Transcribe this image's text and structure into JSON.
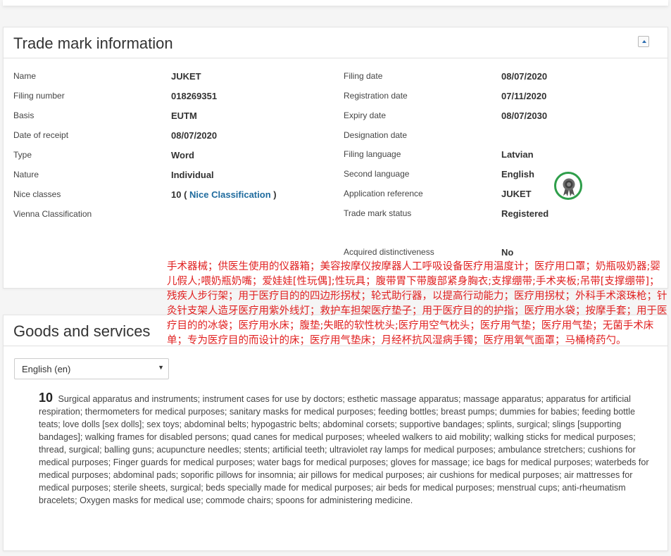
{
  "trade_mark": {
    "title": "Trade mark information",
    "left": [
      {
        "label": "Name",
        "value": "JUKET"
      },
      {
        "label": "Filing number",
        "value": "018269351"
      },
      {
        "label": "Basis",
        "value": "EUTM"
      },
      {
        "label": "Date of receipt",
        "value": "08/07/2020"
      },
      {
        "label": "Type",
        "value": "Word"
      },
      {
        "label": "Nature",
        "value": "Individual"
      },
      {
        "label": "Nice classes",
        "value_prefix": "10 (",
        "link": "Nice Classification",
        "value_suffix": ")"
      },
      {
        "label": "Vienna Classification",
        "value": ""
      }
    ],
    "right": [
      {
        "label": "Filing date",
        "value": "08/07/2020"
      },
      {
        "label": "Registration date",
        "value": "07/11/2020"
      },
      {
        "label": "Expiry date",
        "value": "08/07/2030"
      },
      {
        "label": "Designation date",
        "value": ""
      },
      {
        "label": "Filing language",
        "value": "Latvian"
      },
      {
        "label": "Second language",
        "value": "English"
      },
      {
        "label": "Application reference",
        "value": "JUKET"
      },
      {
        "label": "Trade mark status",
        "value": "Registered"
      },
      {
        "label": "Acquired distinctiveness",
        "value": "No"
      }
    ],
    "status_icon": "registered-ribbon-icon",
    "status_color": "#2e9e4a"
  },
  "overlay_text": "手术器械；供医生使用的仪器箱；美容按摩仪按摩器人工呼吸设备医疗用温度计；医疗用口罩；奶瓶吸奶器;婴儿假人;喂奶瓶奶嘴；爱娃娃[性玩偶];性玩具；腹带胃下带腹部紧身胸衣;支撑绷带;手术夹板;吊带[支撑绷带]；残疾人步行架；用于医疗目的的四边形拐杖；轮式助行器，以提高行动能力；医疗用拐杖；外科手术滚珠枪；针灸针支架人造牙医疗用紫外线灯；救护车担架医疗垫子；用于医疗目的的护指；医疗用水袋；按摩手套；用于医疗目的的冰袋；医疗用水床；腹垫;失眠的软性枕头;医疗用空气枕头；医疗用气垫；医疗用气垫；无菌手术床单；专为医疗目的而设计的床；医疗用气垫床；月经杯抗风湿病手镯；医疗用氧气面罩；马桶椅药勺。",
  "goods": {
    "title": "Goods and services",
    "language_selected": "English (en)",
    "class_number": "10",
    "description": "Surgical apparatus and instruments; instrument cases for use by doctors; esthetic massage apparatus; massage apparatus; apparatus for artificial respiration; thermometers for medical purposes; sanitary masks for medical purposes; feeding bottles; breast pumps; dummies for babies; feeding bottle teats; love dolls [sex dolls]; sex toys; abdominal belts; hypogastric belts; abdominal corsets; supportive bandages; splints, surgical; slings [supporting bandages]; walking frames for disabled persons; quad canes for medical purposes; wheeled walkers to aid mobility; walking sticks for medical purposes; thread, surgical; balling guns; acupuncture needles; stents; artificial teeth; ultraviolet ray lamps for medical purposes; ambulance stretchers; cushions for medical purposes; Finger guards for medical purposes; water bags for medical purposes; gloves for massage; ice bags for medical purposes; waterbeds for medical purposes; abdominal pads; soporific pillows for insomnia; air pillows for medical purposes; air cushions for medical purposes; air mattresses for medical purposes; sterile sheets, surgical; beds specially made for medical purposes; air beds for medical purposes; menstrual cups; anti-rheumatism bracelets; Oxygen masks for medical use; commode chairs; spoons for administering medicine."
  },
  "colors": {
    "link": "#1f6b9e",
    "overlay": "#e02020",
    "accent": "#2b6cb0"
  }
}
